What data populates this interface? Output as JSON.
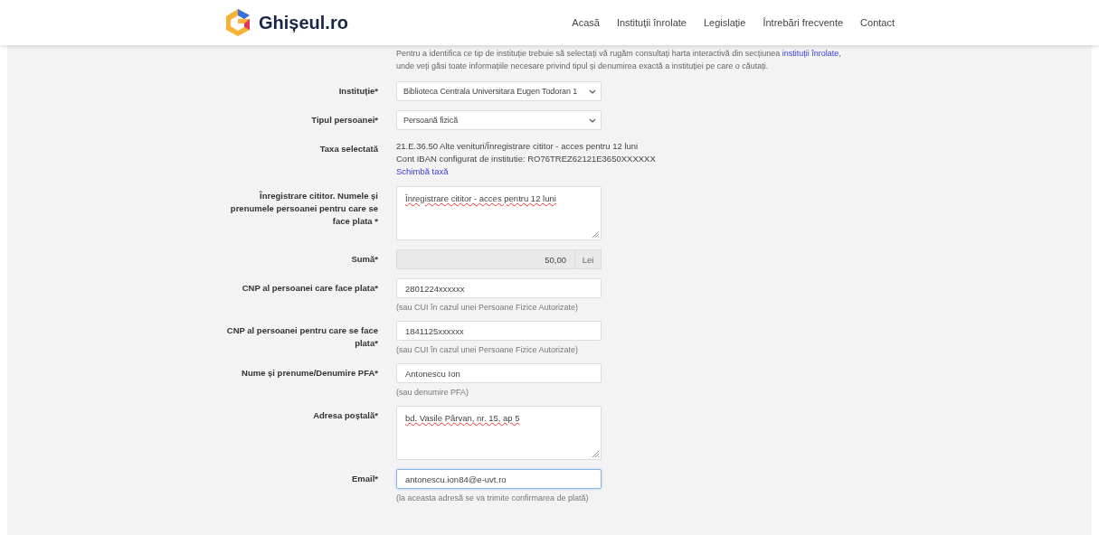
{
  "header": {
    "logo_text": "Ghișeul.ro",
    "nav": [
      "Acasă",
      "Instituții înrolate",
      "Legislație",
      "Întrebări frecvente",
      "Contact"
    ]
  },
  "intro": {
    "text_before": "Pentru a identifica ce tip de instituție trebuie să selectați vă rugăm consultați harta interactivă din secțiunea",
    "link": "instituții înrolate",
    "text_after": ",",
    "line2": "unde veți găsi toate informațiile necesare privind tipul și denumirea exactă a instituției pe care o căutați."
  },
  "fields": [
    {
      "kind": "select",
      "label": "Instituție*",
      "value": "Biblioteca Centrala Universitara Eugen Todoran 1"
    },
    {
      "kind": "select",
      "label": "Tipul persoanei*",
      "value": "Persoană fizică"
    },
    {
      "kind": "info",
      "label": "Taxa selectată",
      "lines": [
        "21.E.36.50 Alte venituri/Înregistrare cititor - acces pentru 12 luni",
        "Cont IBAN configurat de institutie: RO76TREZ62121E3650XXXXXX"
      ],
      "link": "Schimbă taxă"
    },
    {
      "kind": "textarea",
      "label": "Înregistrare cititor. Numele și prenumele persoanei pentru care se face plata *",
      "value": "Înregistrare cititor - acces pentru 12 luni"
    },
    {
      "kind": "amount",
      "label": "Sumă*",
      "value": "50,00",
      "unit": "Lei"
    },
    {
      "kind": "text",
      "label": "CNP al persoanei care face plata*",
      "value": "2801224xxxxxx",
      "hint": "(sau CUI în cazul unei Persoane Fizice Autorizate)",
      "focused": false
    },
    {
      "kind": "text",
      "label": "CNP al persoanei pentru care se face plata*",
      "value": "1841125xxxxxx",
      "hint": "(sau CUI în cazul unei Persoane Fizice Autorizate)",
      "focused": false
    },
    {
      "kind": "text",
      "label": "Nume și prenume/Denumire PFA*",
      "value": "Antonescu Ion",
      "hint": "(sau denumire PFA)",
      "focused": false
    },
    {
      "kind": "textarea",
      "label": "Adresa poștală*",
      "value": "bd. Vasile Pârvan, nr. 15, ap 5"
    },
    {
      "kind": "text",
      "label": "Email*",
      "value": "antonescu.ion84@e-uvt.ro",
      "hint": "(la aceasta adresă se va trimite confirmarea de plată)",
      "focused": true
    }
  ]
}
